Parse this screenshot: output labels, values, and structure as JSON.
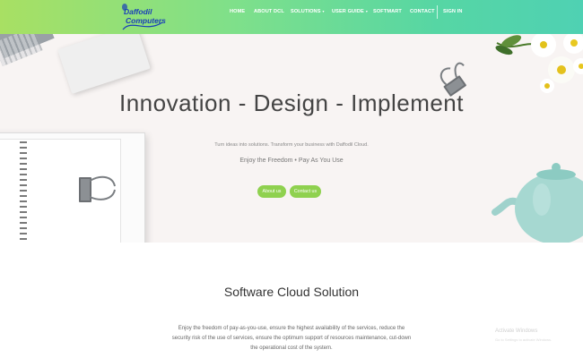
{
  "brand": {
    "logo_line1": "Daffodil",
    "logo_line2": "Computers"
  },
  "nav": {
    "items": [
      {
        "label": "HOME"
      },
      {
        "label": "ABOUT DCL"
      },
      {
        "label": "SOLUTIONS",
        "caret": "▾"
      },
      {
        "label": "USER GUIDE",
        "caret": "▾"
      },
      {
        "label": "SOFTMART"
      },
      {
        "label": "CONTACT"
      },
      {
        "label": "SIGN IN"
      }
    ]
  },
  "hero": {
    "title": "Innovation - Design - Implement",
    "subtitle": "Turn ideas into solutions. Transform your business with Daffodil Cloud.",
    "tagline": "Enjoy the Freedom • Pay As You Use",
    "buttons": {
      "about": "About us",
      "contact": "Contact us"
    }
  },
  "section": {
    "title": "Software Cloud Solution",
    "text": "Enjoy the freedom of pay-as-you-use, ensure the highest availability of the services, reduce the security risk of the use of services, ensure the optimum support of resources maintenance, cut-down the operational cost of the system."
  },
  "watermark": {
    "line1": "Activate Windows",
    "line2": "Go to Settings to activate Windows."
  },
  "colors": {
    "nav_gradient_start": "#a8e063",
    "nav_gradient_end": "#4fd1b3",
    "button_green": "#8fd14f",
    "logo_blue": "#1a3fb8"
  }
}
